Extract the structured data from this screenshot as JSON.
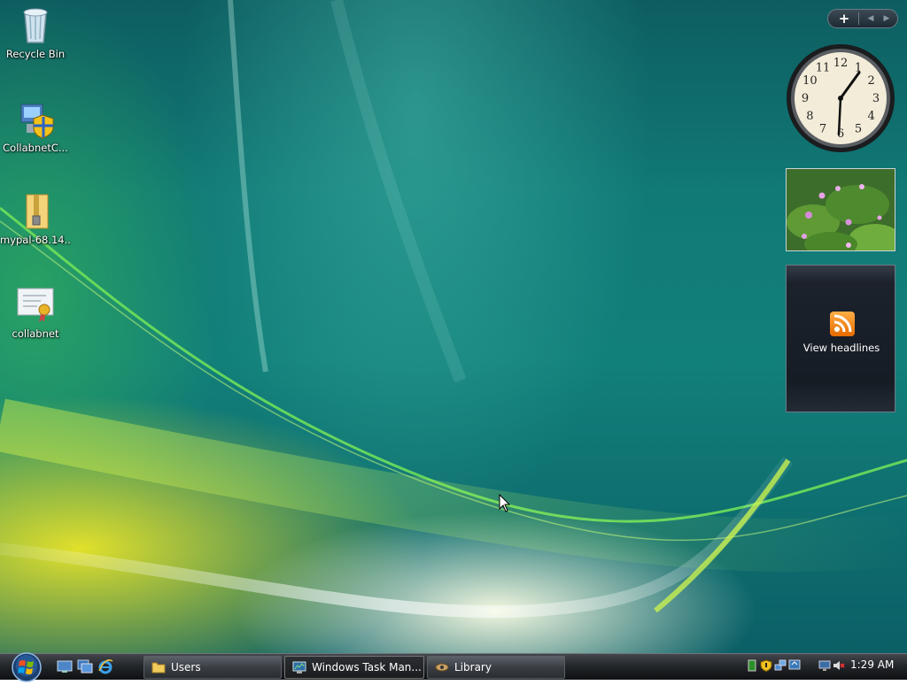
{
  "desktop": {
    "icons": [
      {
        "label": "Recycle Bin",
        "icon": "recycle-bin-icon"
      },
      {
        "label": "CollabnetC...",
        "icon": "installer-shield-icon"
      },
      {
        "label": "mypal-68.14....",
        "icon": "zip-folder-icon"
      },
      {
        "label": "collabnet",
        "icon": "certificate-icon"
      }
    ]
  },
  "sidebar": {
    "add_label": "+",
    "prev_label": "◀",
    "next_label": "▶",
    "clock": {
      "hour_marks": [
        "12",
        "1",
        "2",
        "3",
        "4",
        "5",
        "6",
        "7",
        "8",
        "9",
        "10",
        "11"
      ],
      "time": "1:29"
    },
    "feeds": {
      "text": "View headlines",
      "icon": "rss-icon"
    }
  },
  "taskbar": {
    "start": {
      "icon": "windows-orb-icon"
    },
    "quick_launch": [
      {
        "icon": "show-desktop-icon"
      },
      {
        "icon": "switch-windows-icon"
      },
      {
        "icon": "internet-explorer-icon"
      }
    ],
    "buttons": [
      {
        "label": "Users",
        "icon": "folder-icon",
        "active": false
      },
      {
        "label": "Windows Task Man...",
        "icon": "task-manager-icon",
        "active": true
      },
      {
        "label": "Library",
        "icon": "library-icon",
        "active": false
      }
    ],
    "tray": {
      "icons": [
        "battery-icon",
        "security-shield-icon",
        "network-icon",
        "volume-muted-icon"
      ],
      "time": "1:29 AM"
    }
  },
  "colors": {
    "taskbar": "#24272b",
    "desktop_base": "#117a77",
    "rss": "#f58220"
  }
}
